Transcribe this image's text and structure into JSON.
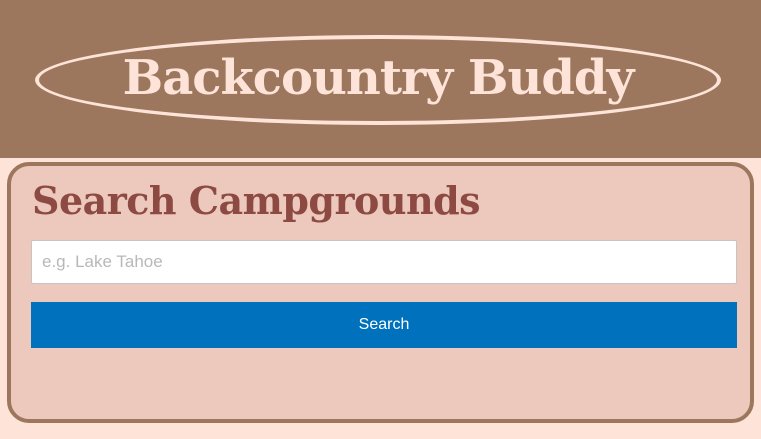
{
  "header": {
    "title": "Backcountry Buddy"
  },
  "search_panel": {
    "heading": "Search Campgrounds",
    "input_placeholder": "e.g. Lake Tahoe",
    "input_value": "",
    "button_label": "Search"
  },
  "colors": {
    "header_bg": "#9c775d",
    "page_bg": "#fde3d8",
    "panel_bg": "#ecc9bc",
    "heading_text": "#8d4a42",
    "button_bg": "#0071bc"
  }
}
